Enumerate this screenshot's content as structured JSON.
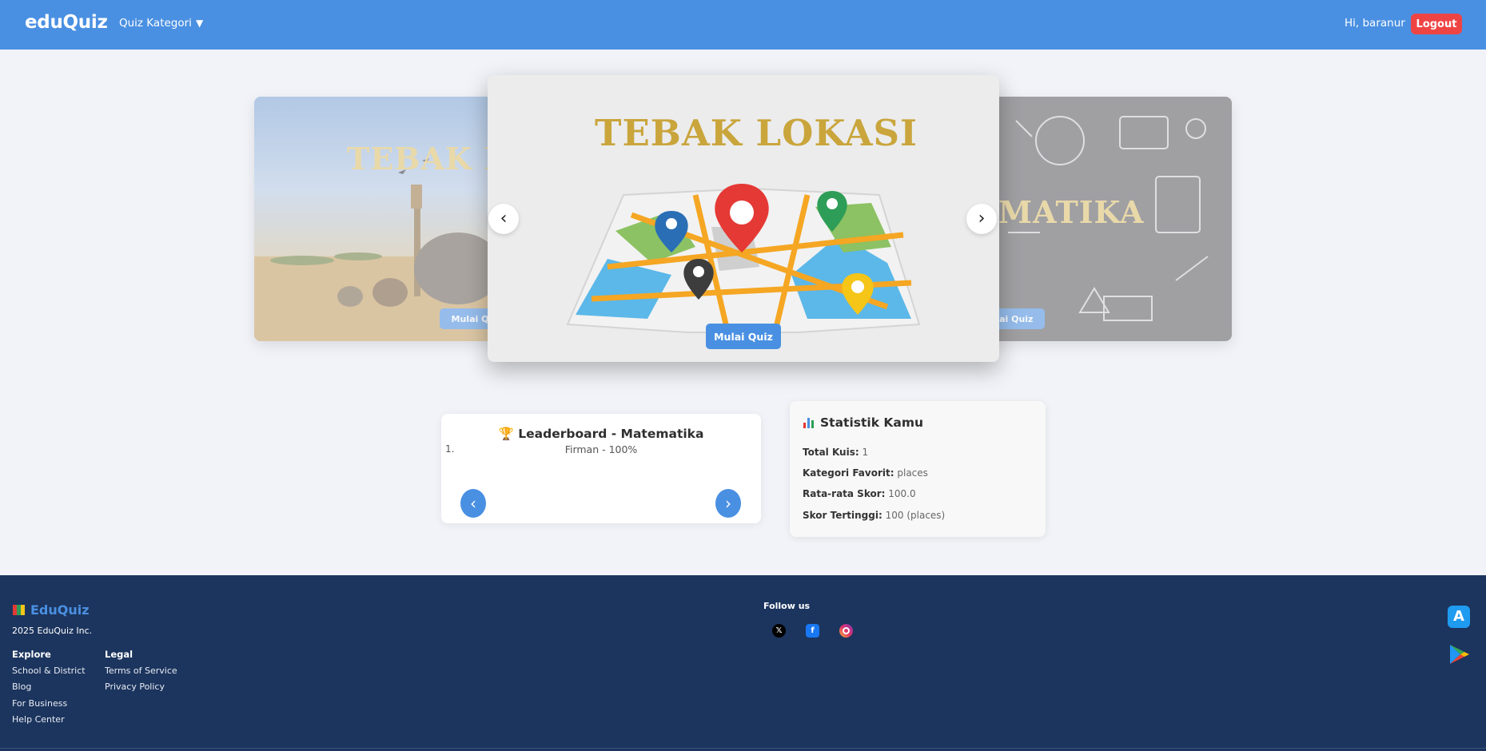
{
  "header": {
    "brand": "eduQuiz",
    "category_menu": "Quiz Kategori",
    "greeting": "Hi, baranur",
    "logout": "Logout"
  },
  "carousel": {
    "prev_arrow": "‹",
    "next_arrow": "›",
    "slides": [
      {
        "title": "TEBAK H",
        "button": "Mulai Quiz"
      },
      {
        "title": "TEBAK LOKASI",
        "button": "Mulai Quiz"
      },
      {
        "title": "MATIKA",
        "button": "Mulai Quiz"
      }
    ]
  },
  "leaderboard": {
    "title": "Leaderboard - Matematika",
    "entries": [
      {
        "rank": "1.",
        "text": "Firman - 100%"
      }
    ],
    "prev": "‹",
    "next": "›"
  },
  "stats": {
    "title": "Statistik Kamu",
    "rows": [
      {
        "label": "Total Kuis:",
        "value": "1"
      },
      {
        "label": "Kategori Favorit:",
        "value": "places"
      },
      {
        "label": "Rata-rata Skor:",
        "value": "100.0"
      },
      {
        "label": "Skor Tertinggi:",
        "value": "100 (places)"
      }
    ]
  },
  "footer": {
    "brand": "EduQuiz",
    "copyright": "2025 EduQuiz Inc.",
    "explore": {
      "heading": "Explore",
      "links": [
        "School & District",
        "Blog",
        "For Business",
        "Help Center"
      ]
    },
    "legal": {
      "heading": "Legal",
      "links": [
        "Terms of Service",
        "Privacy Policy"
      ]
    },
    "follow_us": "Follow us",
    "social": {
      "x": "𝕏",
      "facebook": "f"
    }
  },
  "colors": {
    "primary": "#4a90e2",
    "logout": "#ef4444",
    "footer_bg": "#1c355e",
    "title_gold": "#c9a53c"
  }
}
